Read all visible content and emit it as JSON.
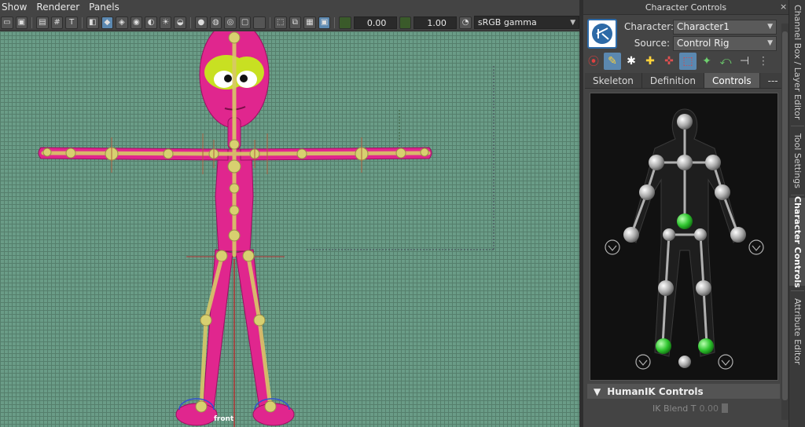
{
  "viewport": {
    "menus": [
      "Show",
      "Renderer",
      "Panels"
    ],
    "exposure_value": "0.00",
    "gamma_value": "1.00",
    "color_management": "sRGB gamma",
    "camera_label": "front",
    "toolbar_icons": [
      "camera-icon",
      "bookmark-icon",
      "image-plane-icon",
      "grid-icon",
      "text-icon",
      "cube-icon",
      "xray-icon",
      "wireframe-icon",
      "smooth-shade-icon",
      "textured-icon",
      "lights-icon",
      "shadows-icon",
      "isolate-icon",
      "ssao-icon",
      "select-icon",
      "frame-all-icon",
      "frame-selected-icon",
      "resolution-gate-icon"
    ]
  },
  "panel": {
    "title": "Character Controls",
    "character_label": "Character:",
    "character_value": "Character1",
    "source_label": "Source:",
    "source_value": "Control Rig",
    "tabs": [
      "Skeleton",
      "Definition",
      "Controls",
      "---"
    ],
    "active_tab": "Controls",
    "section_title": "HumanIK Controls",
    "ik_blend_label": "IK Blend T",
    "ik_blend_value": "0.00",
    "close_glyph": "×",
    "colors": {
      "effector_green": "#2fc52f",
      "effector_grey": "#b5b5b5",
      "accent_blue": "#5b88b0"
    }
  },
  "side_tabs": [
    "Channel Box / Layer Editor",
    "Tool Settings",
    "Character Controls",
    "Attribute Editor"
  ],
  "active_side_tab": "Character Controls"
}
